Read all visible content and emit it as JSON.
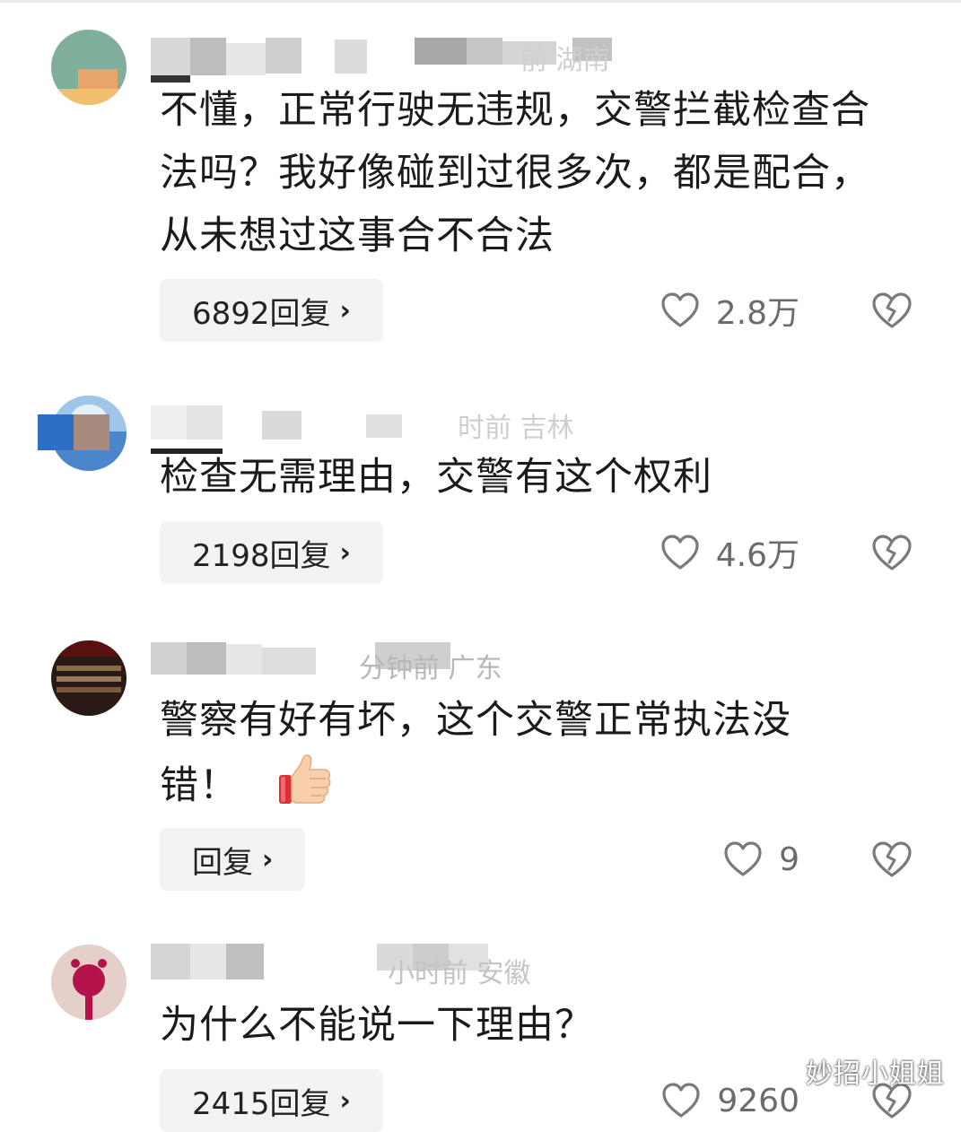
{
  "comments": [
    {
      "meta": "前 湖南",
      "text": "不懂，正常行驶无违规，交警拦截检查合法吗？我好像碰到过很多次，都是配合，从未想过这事合不合法",
      "reply_label": "6892回复",
      "likes": "2.8万"
    },
    {
      "meta": "时前 吉林",
      "text": "检查无需理由，交警有这个权利",
      "reply_label": "2198回复",
      "likes": "4.6万"
    },
    {
      "meta": "分钟前 广东",
      "text": "警察有好有坏，这个交警正常执法没错！",
      "emoji": "👍",
      "reply_label": "回复",
      "likes": "9"
    },
    {
      "meta": "小时前 安徽",
      "text": "为什么不能说一下理由？",
      "reply_label": "2415回复",
      "likes": "9260"
    }
  ],
  "watermark": "妙招小姐姐",
  "icons": {
    "like": "heart-outline-icon",
    "dislike": "broken-heart-icon",
    "chevron": "chevron-right-icon"
  },
  "colors": {
    "text": "#1b1b1b",
    "meta": "#b7b7b7",
    "button_bg": "#f2f3f5",
    "icon": "#6b6b6b"
  }
}
